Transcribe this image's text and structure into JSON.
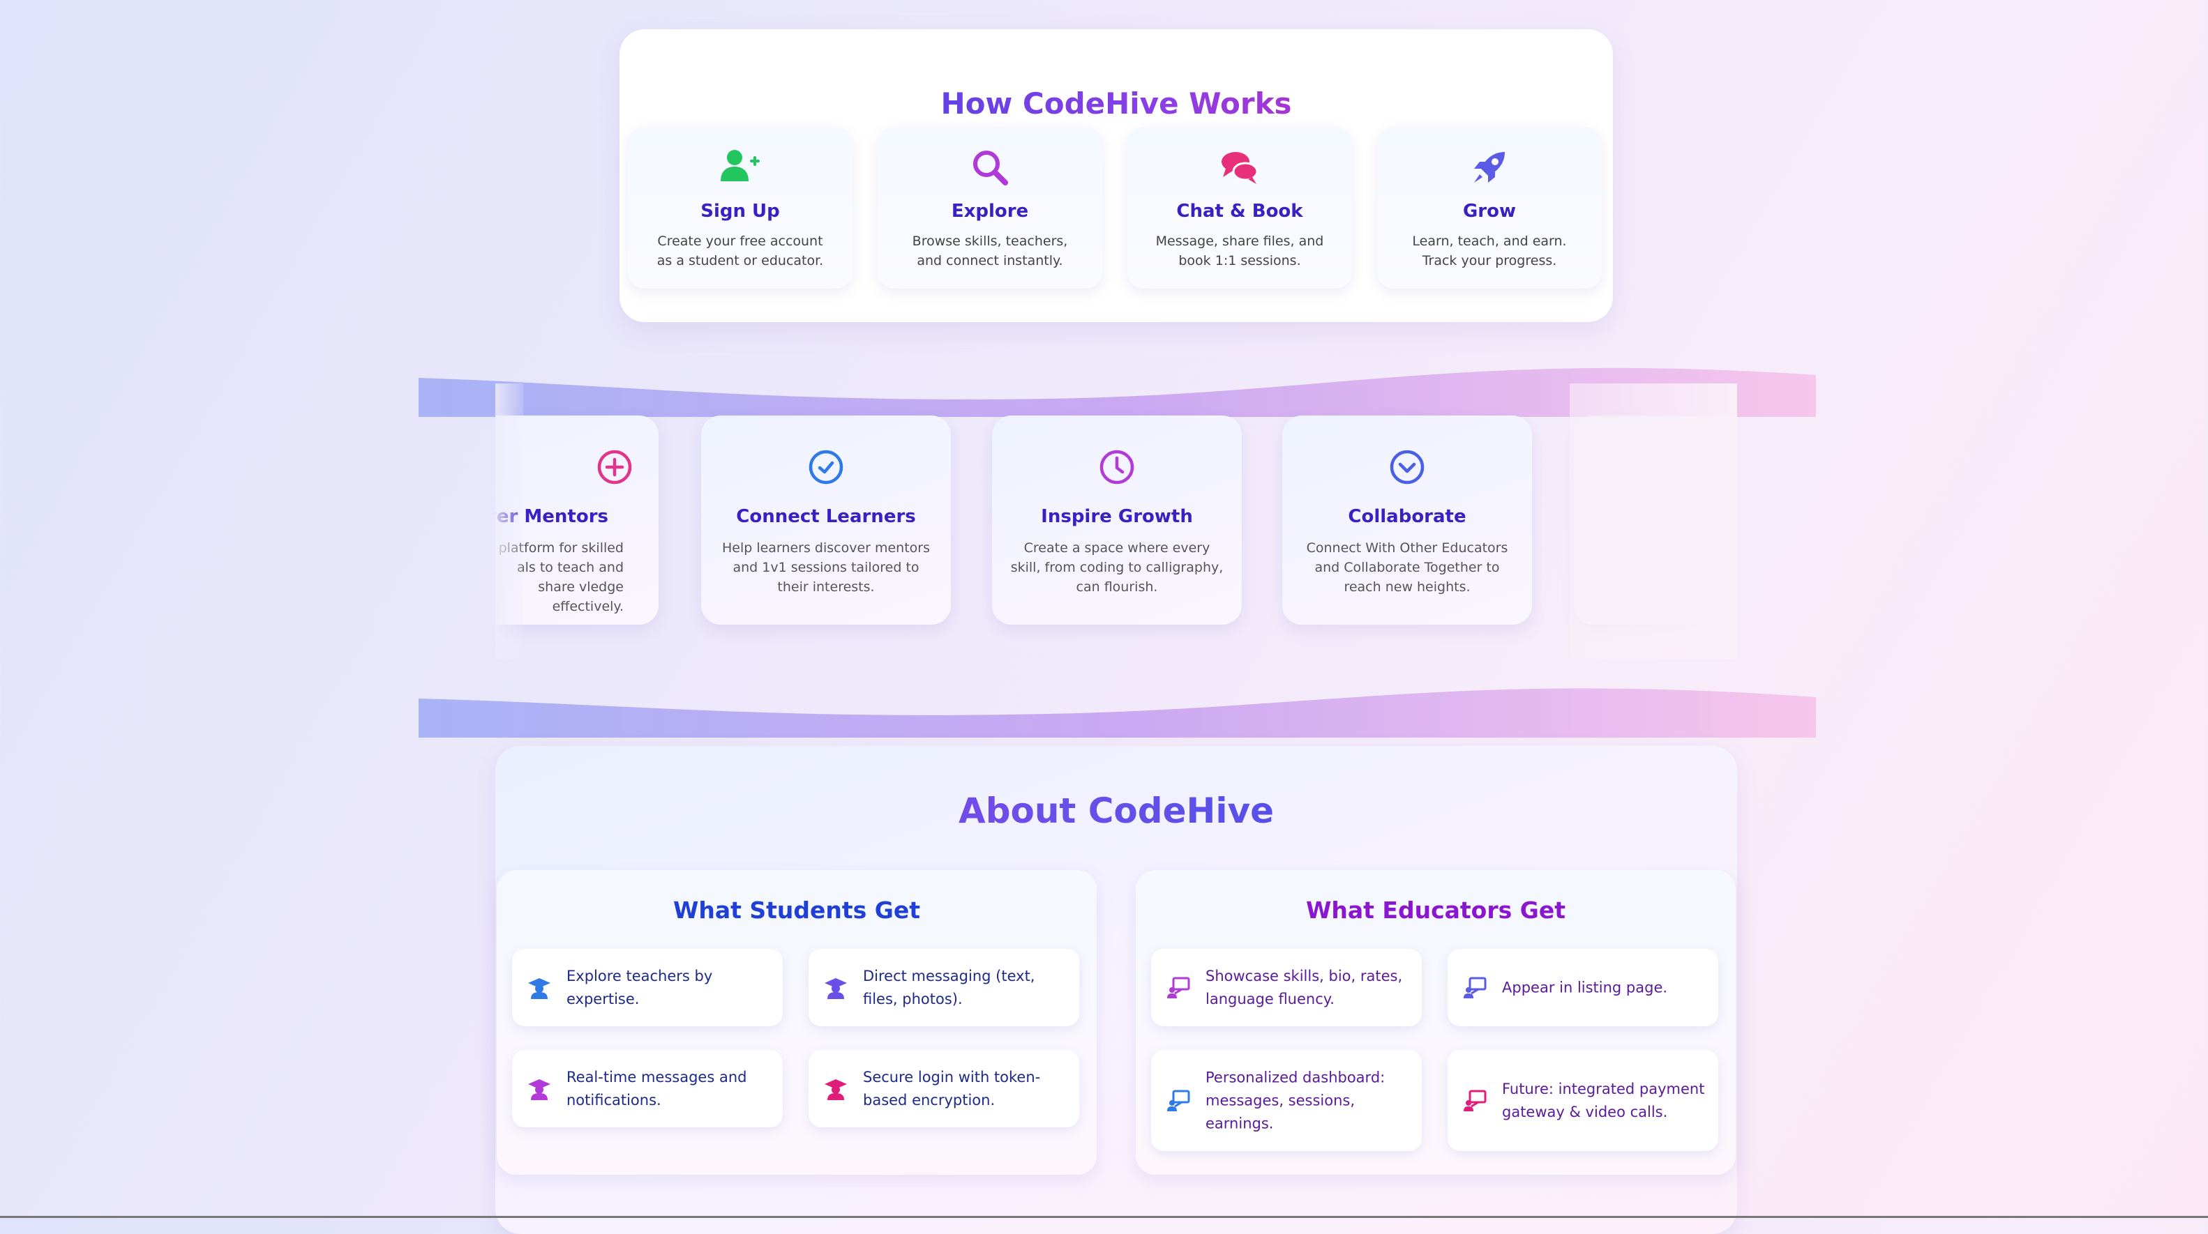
{
  "how": {
    "title": "How CodeHive Works",
    "steps": [
      {
        "icon": "user-plus-icon",
        "title": "Sign Up",
        "desc": "Create your free account as a student or educator."
      },
      {
        "icon": "search-icon",
        "title": "Explore",
        "desc": "Browse skills, teachers, and connect instantly."
      },
      {
        "icon": "chat-icon",
        "title": "Chat & Book",
        "desc": "Message, share files, and book 1:1 sessions."
      },
      {
        "icon": "rocket-icon",
        "title": "Grow",
        "desc": "Learn, teach, and earn. Track your progress."
      }
    ]
  },
  "mission": {
    "cards": [
      {
        "icon": "plus-circle-icon",
        "title": "ower Mentors",
        "desc": "a platform for skilled als to teach and share vledge effectively."
      },
      {
        "icon": "check-circle-icon",
        "title": "Connect Learners",
        "desc": "Help learners discover mentors and 1v1 sessions tailored to their interests."
      },
      {
        "icon": "clock-icon",
        "title": "Inspire Growth",
        "desc": "Create a space where every skill, from coding to calligraphy, can flourish."
      },
      {
        "icon": "chevron-circle-icon",
        "title": "Collaborate",
        "desc": "Connect With Other Educators and Collaborate Together to reach new heights."
      }
    ]
  },
  "about": {
    "title": "About CodeHive",
    "students": {
      "heading": "What Students Get",
      "items": [
        {
          "icon": "graduate-icon",
          "text": "Explore teachers by expertise."
        },
        {
          "icon": "graduate-icon",
          "text": "Direct messaging (text, files, photos)."
        },
        {
          "icon": "graduate-icon",
          "text": "Real-time messages and notifications."
        },
        {
          "icon": "graduate-icon",
          "text": "Secure login with token-based encryption."
        }
      ]
    },
    "educators": {
      "heading": "What Educators Get",
      "items": [
        {
          "icon": "teacher-board-icon",
          "text": "Showcase skills, bio, rates, language fluency."
        },
        {
          "icon": "teacher-board-icon",
          "text": "Appear in listing page."
        },
        {
          "icon": "teacher-board-icon",
          "text": "Personalized dashboard: messages, sessions, earnings."
        },
        {
          "icon": "teacher-board-icon",
          "text": "Future: integrated payment gateway & video calls."
        }
      ]
    }
  },
  "colors": {
    "accent_blue": "#2b48e0",
    "accent_purple": "#8b3ee6",
    "accent_pink": "#e11da0",
    "heading_text": "#3a1fc2"
  }
}
